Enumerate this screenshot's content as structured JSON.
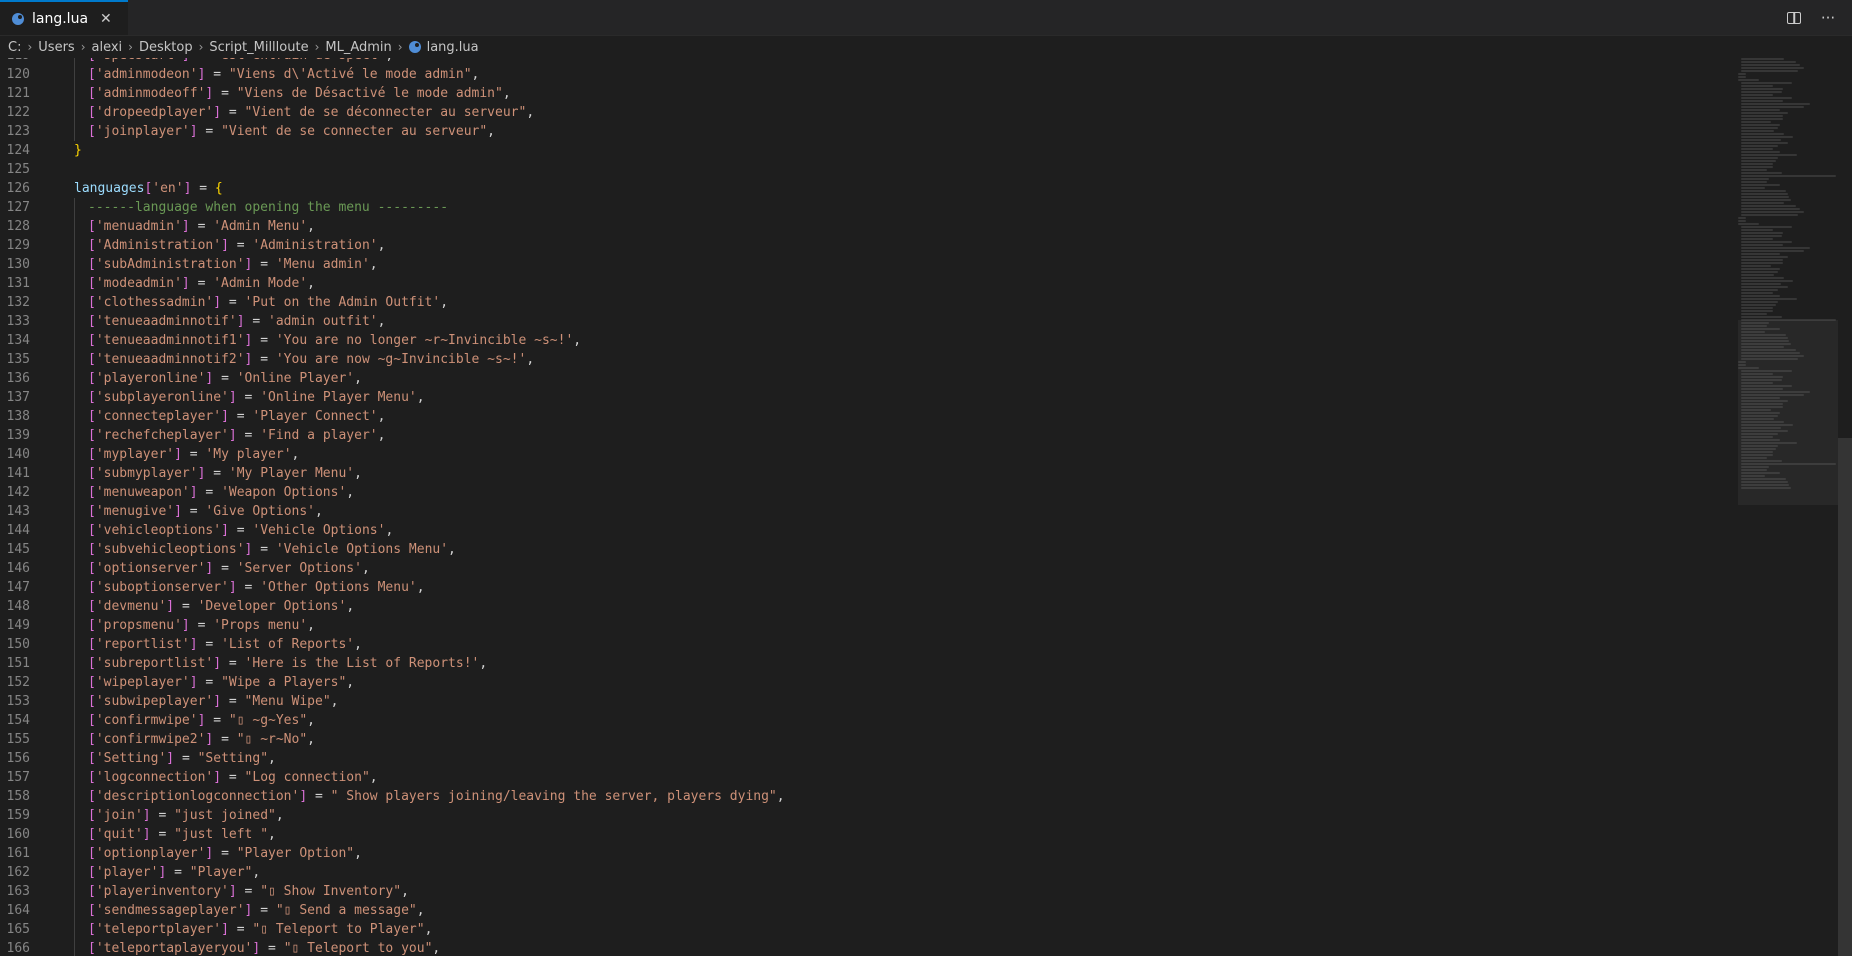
{
  "tab": {
    "title": "lang.lua",
    "close_glyph": "✕"
  },
  "header_actions": {
    "more_glyph": "···"
  },
  "breadcrumbs": [
    "C:",
    "Users",
    "alexi",
    "Desktop",
    "Script_Millloute",
    "ML_Admin",
    "lang.lua"
  ],
  "code_lines": [
    {
      "n": "119",
      "i": 1,
      "t": "['specstart'] = \"est entrain de spect\","
    },
    {
      "n": "120",
      "i": 1,
      "t": "['adminmodeon'] = \"Viens d\\'Activé le mode admin\","
    },
    {
      "n": "121",
      "i": 1,
      "t": "['adminmodeoff'] = \"Viens de Désactivé le mode admin\","
    },
    {
      "n": "122",
      "i": 1,
      "t": "['dropeedplayer'] = \"Vient de se déconnecter au serveur\","
    },
    {
      "n": "123",
      "i": 1,
      "t": "['joinplayer'] = \"Vient de se connecter au serveur\","
    },
    {
      "n": "124",
      "i": 0,
      "t": "}"
    },
    {
      "n": "125",
      "i": 0,
      "t": ""
    },
    {
      "n": "126",
      "i": 0,
      "t": "languages['en'] = {"
    },
    {
      "n": "127",
      "i": 1,
      "t": "------language when opening the menu ---------"
    },
    {
      "n": "128",
      "i": 1,
      "t": "['menuadmin'] = 'Admin Menu',"
    },
    {
      "n": "129",
      "i": 1,
      "t": "['Administration'] = 'Administration',"
    },
    {
      "n": "130",
      "i": 1,
      "t": "['subAdministration'] = 'Menu admin',"
    },
    {
      "n": "131",
      "i": 1,
      "t": "['modeadmin'] = 'Admin Mode',"
    },
    {
      "n": "132",
      "i": 1,
      "t": "['clothessadmin'] = 'Put on the Admin Outfit',"
    },
    {
      "n": "133",
      "i": 1,
      "t": "['tenueaadminnotif'] = 'admin outfit',"
    },
    {
      "n": "134",
      "i": 1,
      "t": "['tenueaadminnotif1'] = 'You are no longer ~r~Invincible ~s~!',"
    },
    {
      "n": "135",
      "i": 1,
      "t": "['tenueaadminnotif2'] = 'You are now ~g~Invincible ~s~!',"
    },
    {
      "n": "136",
      "i": 1,
      "t": "['playeronline'] = 'Online Player',"
    },
    {
      "n": "137",
      "i": 1,
      "t": "['subplayeronline'] = 'Online Player Menu',"
    },
    {
      "n": "138",
      "i": 1,
      "t": "['connecteplayer'] = 'Player Connect',"
    },
    {
      "n": "139",
      "i": 1,
      "t": "['rechefcheplayer'] = 'Find a player',"
    },
    {
      "n": "140",
      "i": 1,
      "t": "['myplayer'] = 'My player',"
    },
    {
      "n": "141",
      "i": 1,
      "t": "['submyplayer'] = 'My Player Menu',"
    },
    {
      "n": "142",
      "i": 1,
      "t": "['menuweapon'] = 'Weapon Options',"
    },
    {
      "n": "143",
      "i": 1,
      "t": "['menugive'] = 'Give Options',"
    },
    {
      "n": "144",
      "i": 1,
      "t": "['vehicleoptions'] = 'Vehicle Options',"
    },
    {
      "n": "145",
      "i": 1,
      "t": "['subvehicleoptions'] = 'Vehicle Options Menu',"
    },
    {
      "n": "146",
      "i": 1,
      "t": "['optionserver'] = 'Server Options',"
    },
    {
      "n": "147",
      "i": 1,
      "t": "['suboptionserver'] = 'Other Options Menu',"
    },
    {
      "n": "148",
      "i": 1,
      "t": "['devmenu'] = 'Developer Options',"
    },
    {
      "n": "149",
      "i": 1,
      "t": "['propsmenu'] = 'Props menu',"
    },
    {
      "n": "150",
      "i": 1,
      "t": "['reportlist'] = 'List of Reports',"
    },
    {
      "n": "151",
      "i": 1,
      "t": "['subreportlist'] = 'Here is the List of Reports!',"
    },
    {
      "n": "152",
      "i": 1,
      "t": "['wipeplayer'] = \"Wipe a Players\","
    },
    {
      "n": "153",
      "i": 1,
      "t": "['subwipeplayer'] = \"Menu Wipe\","
    },
    {
      "n": "154",
      "i": 1,
      "t": "['confirmwipe'] = \"▯ ~g~Yes\","
    },
    {
      "n": "155",
      "i": 1,
      "t": "['confirmwipe2'] = \"▯ ~r~No\","
    },
    {
      "n": "156",
      "i": 1,
      "t": "['Setting'] = \"Setting\","
    },
    {
      "n": "157",
      "i": 1,
      "t": "['logconnection'] = \"Log connection\","
    },
    {
      "n": "158",
      "i": 1,
      "t": "['descriptionlogconnection'] = \" Show players joining/leaving the server, players dying\","
    },
    {
      "n": "159",
      "i": 1,
      "t": "['join'] = \"just joined\","
    },
    {
      "n": "160",
      "i": 1,
      "t": "['quit'] = \"just left \","
    },
    {
      "n": "161",
      "i": 1,
      "t": "['optionplayer'] = \"Player Option\","
    },
    {
      "n": "162",
      "i": 1,
      "t": "['player'] = \"Player\","
    },
    {
      "n": "163",
      "i": 1,
      "t": "['playerinventory'] = \"▯ Show Inventory\","
    },
    {
      "n": "164",
      "i": 1,
      "t": "['sendmessageplayer'] = \"▯ Send a message\","
    },
    {
      "n": "165",
      "i": 1,
      "t": "['teleportplayer'] = \"▯ Teleport to Player\","
    },
    {
      "n": "166",
      "i": 1,
      "t": "['teleportaplayeryou'] = \"▯ Teleport to you\","
    }
  ]
}
